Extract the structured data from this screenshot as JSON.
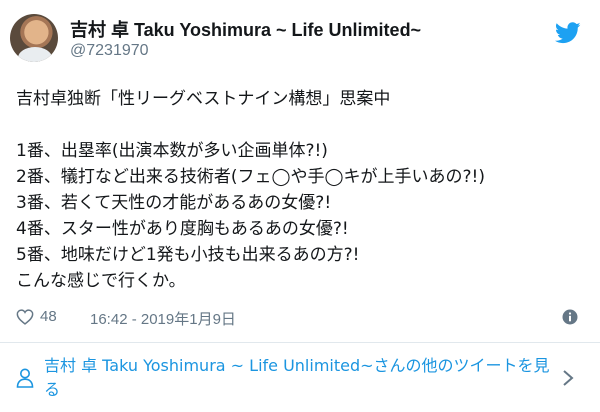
{
  "author": {
    "name": "吉村 卓 Taku Yoshimura ~ Life Unlimited~",
    "handle": "@7231970"
  },
  "icons": {
    "avatar": "profile-photo",
    "logo": "twitter-bird-icon",
    "like": "heart-icon",
    "info": "info-icon",
    "more": "person-icon",
    "chevron": "chevron-right-icon"
  },
  "tweet": {
    "lines": [
      "吉村卓独断「性リーグベストナイン構想」思案中",
      "",
      "1番、出塁率(出演本数が多い企画単体?!)",
      "2番、犠打など出来る技術者(フェ◯や手◯キが上手いあの?!)",
      "3番、若くて天性の才能があるあの女優?!",
      "4番、スター性があり度胸もあるあの女優?!",
      "5番、地味だけど1発も小技も出来るあの方?!",
      "こんな感じで行くか。"
    ]
  },
  "footer": {
    "likes": "48",
    "timestamp": "16:42 - 2019年1月9日"
  },
  "more_tweets": {
    "label": "吉村 卓 Taku Yoshimura ~ Life Unlimited~さんの他のツイートを見る"
  },
  "colors": {
    "link": "#1b95e0",
    "twitter_blue": "#1da1f2",
    "muted": "#657786",
    "text": "#14171a",
    "divider": "#e1e8ed"
  }
}
